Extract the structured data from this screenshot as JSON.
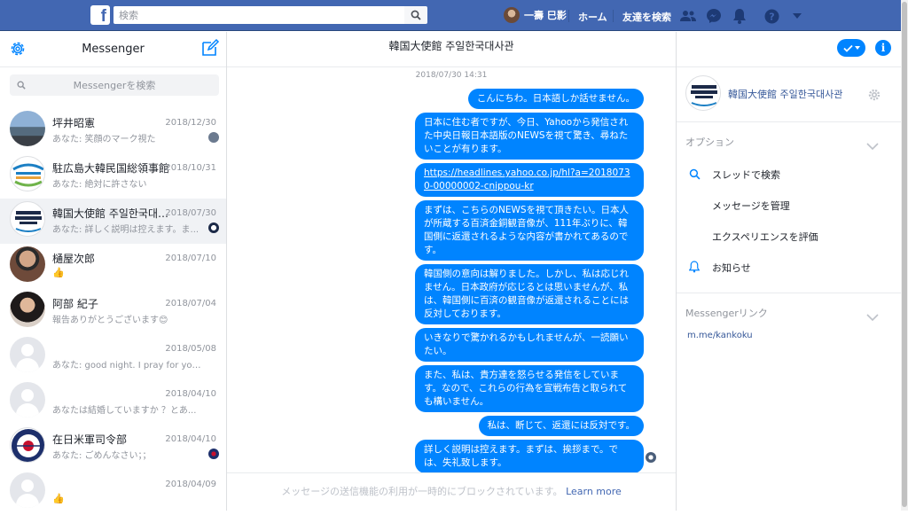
{
  "topbar": {
    "logo": "f",
    "search_placeholder": "検索",
    "user_name": "一壽 巳影",
    "home_label": "ホーム",
    "find_friends_label": "友達を検索"
  },
  "sidebar": {
    "title": "Messenger",
    "search_placeholder": "Messengerを検索",
    "conversations": [
      {
        "name": "坪井昭憲",
        "date": "2018/12/30",
        "snippet": "あなた: 笑顔のマーク視た"
      },
      {
        "name": "駐広島大韓民国総領事館",
        "date": "2018/10/31",
        "snippet": "あなた: 絶対に許さない"
      },
      {
        "name": "韓国大使館 주일한국대사관",
        "date": "2018/07/30",
        "snippet": "あなた: 詳しく説明は控えます。ま..."
      },
      {
        "name": "樋屋次郎",
        "date": "2018/07/10",
        "snippet": ""
      },
      {
        "name": "阿部 紀子",
        "date": "2018/07/04",
        "snippet": "報告ありがとうございます😊"
      },
      {
        "name": "",
        "date": "2018/05/08",
        "snippet": "あなた: good night. I pray for your ..."
      },
      {
        "name": "",
        "date": "2018/04/10",
        "snippet": "あなたは結婚していますか ？とあ..."
      },
      {
        "name": "在日米軍司令部",
        "date": "2018/04/10",
        "snippet": "あなた: ごめんなさい；；"
      },
      {
        "name": "",
        "date": "2018/04/09",
        "snippet": ""
      }
    ]
  },
  "chat": {
    "title": "韓国大使館 주일한국대사관",
    "timestamp": "2018/07/30 14:31",
    "messages": [
      "こんにちわ。日本語しか話せません。",
      "日本に住む者ですが、今日、Yahooから発信された中央日報日本語版のNEWSを視て驚き、尋ねたいことが有ります。",
      "https://headlines.yahoo.co.jp/hl?a=20180730-00000002-cnippou-kr",
      "まずは、こちらのNEWSを視て頂きたい。日本人が所蔵する百済金銅観音像が、111年ぶりに、韓国側に返還されるような内容が書かれてあるのです。",
      "韓国側の意向は解りました。しかし、私は応じれません。日本政府が応じるとは思いませんが、私は、韓国側に百済の観音像が返還されることには反対しております。",
      "いきなりで驚かれるかもしれませんが、一読願いたい。",
      "また、私は、貴方達を怒らせる発信をしています。なので、これらの行為を宣戦布告と取られても構いません。",
      "私は、断じて、返還には反対です。",
      "詳しく説明は控えます。まずは、挨拶まで。では、失礼致します。"
    ],
    "blocked_notice": "メッセージの送信機能の利用が一時的にブロックされています。",
    "learn_more": "Learn more"
  },
  "details": {
    "name": "韓国大使館 주일한국대사관",
    "options_label": "オプション",
    "items": [
      {
        "label": "スレッドで検索",
        "icon": "search-icon"
      },
      {
        "label": "メッセージを管理",
        "icon": ""
      },
      {
        "label": "エクスペリエンスを評価",
        "icon": ""
      },
      {
        "label": "お知らせ",
        "icon": "bell-icon"
      }
    ],
    "links_label": "Messengerリンク",
    "link": "m.me/kankoku"
  },
  "colors": {
    "brand": "#4267b2",
    "bubble": "#0084ff"
  }
}
